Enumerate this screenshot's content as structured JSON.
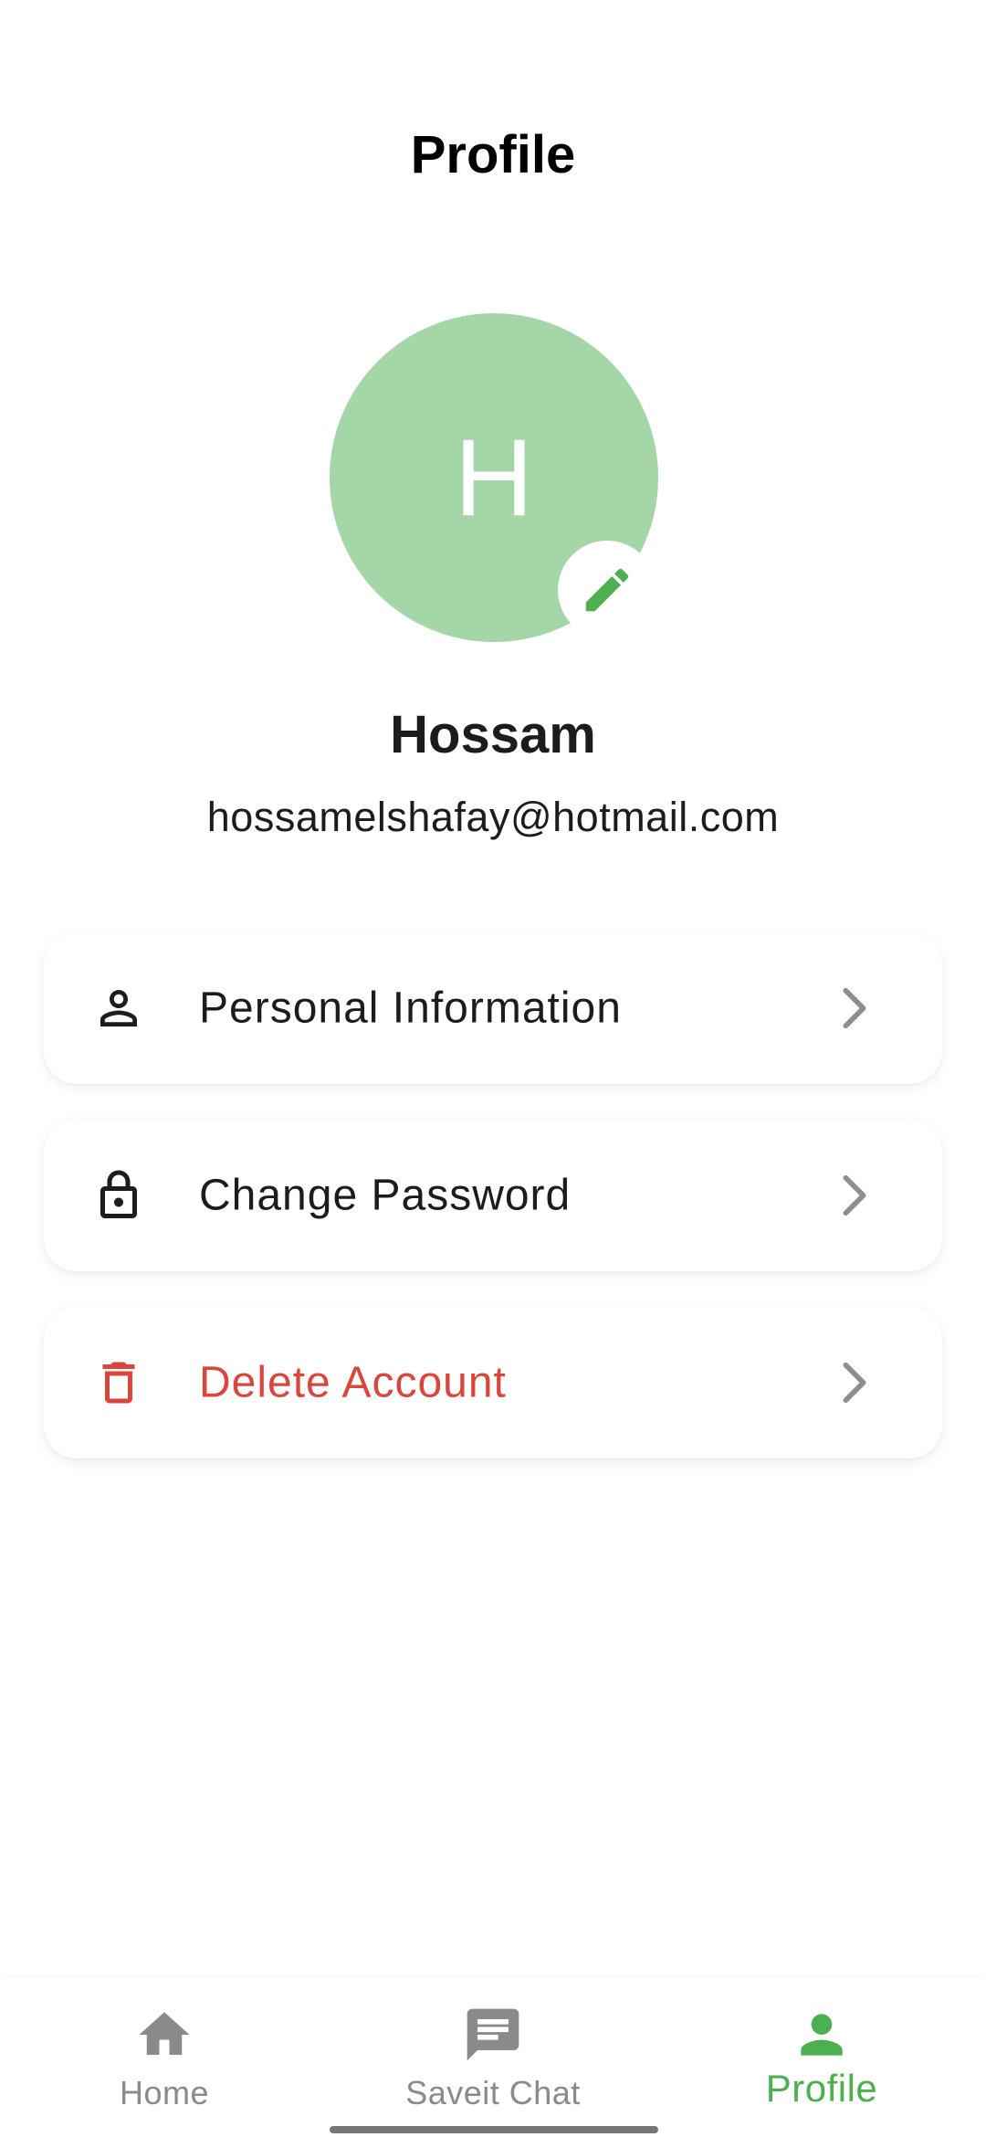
{
  "header": {
    "title": "Profile"
  },
  "profile": {
    "avatar_letter": "H",
    "name": "Hossam",
    "email": "hossamelshafay@hotmail.com",
    "avatar_color": "#a5d6a7",
    "edit_icon": "pencil-icon"
  },
  "menu": {
    "items": [
      {
        "label": "Personal Information",
        "icon": "person-icon"
      },
      {
        "label": "Change Password",
        "icon": "lock-icon"
      },
      {
        "label": "Delete Account",
        "icon": "trash-icon",
        "color": "#d9463c"
      }
    ]
  },
  "bottom_nav": {
    "items": [
      {
        "label": "Home",
        "icon": "home-icon",
        "active": false
      },
      {
        "label": "Saveit Chat",
        "icon": "chat-icon",
        "active": false
      },
      {
        "label": "Profile",
        "icon": "person-icon",
        "active": true
      }
    ],
    "active_color": "#4caf50",
    "inactive_color": "#8a8a8a"
  }
}
